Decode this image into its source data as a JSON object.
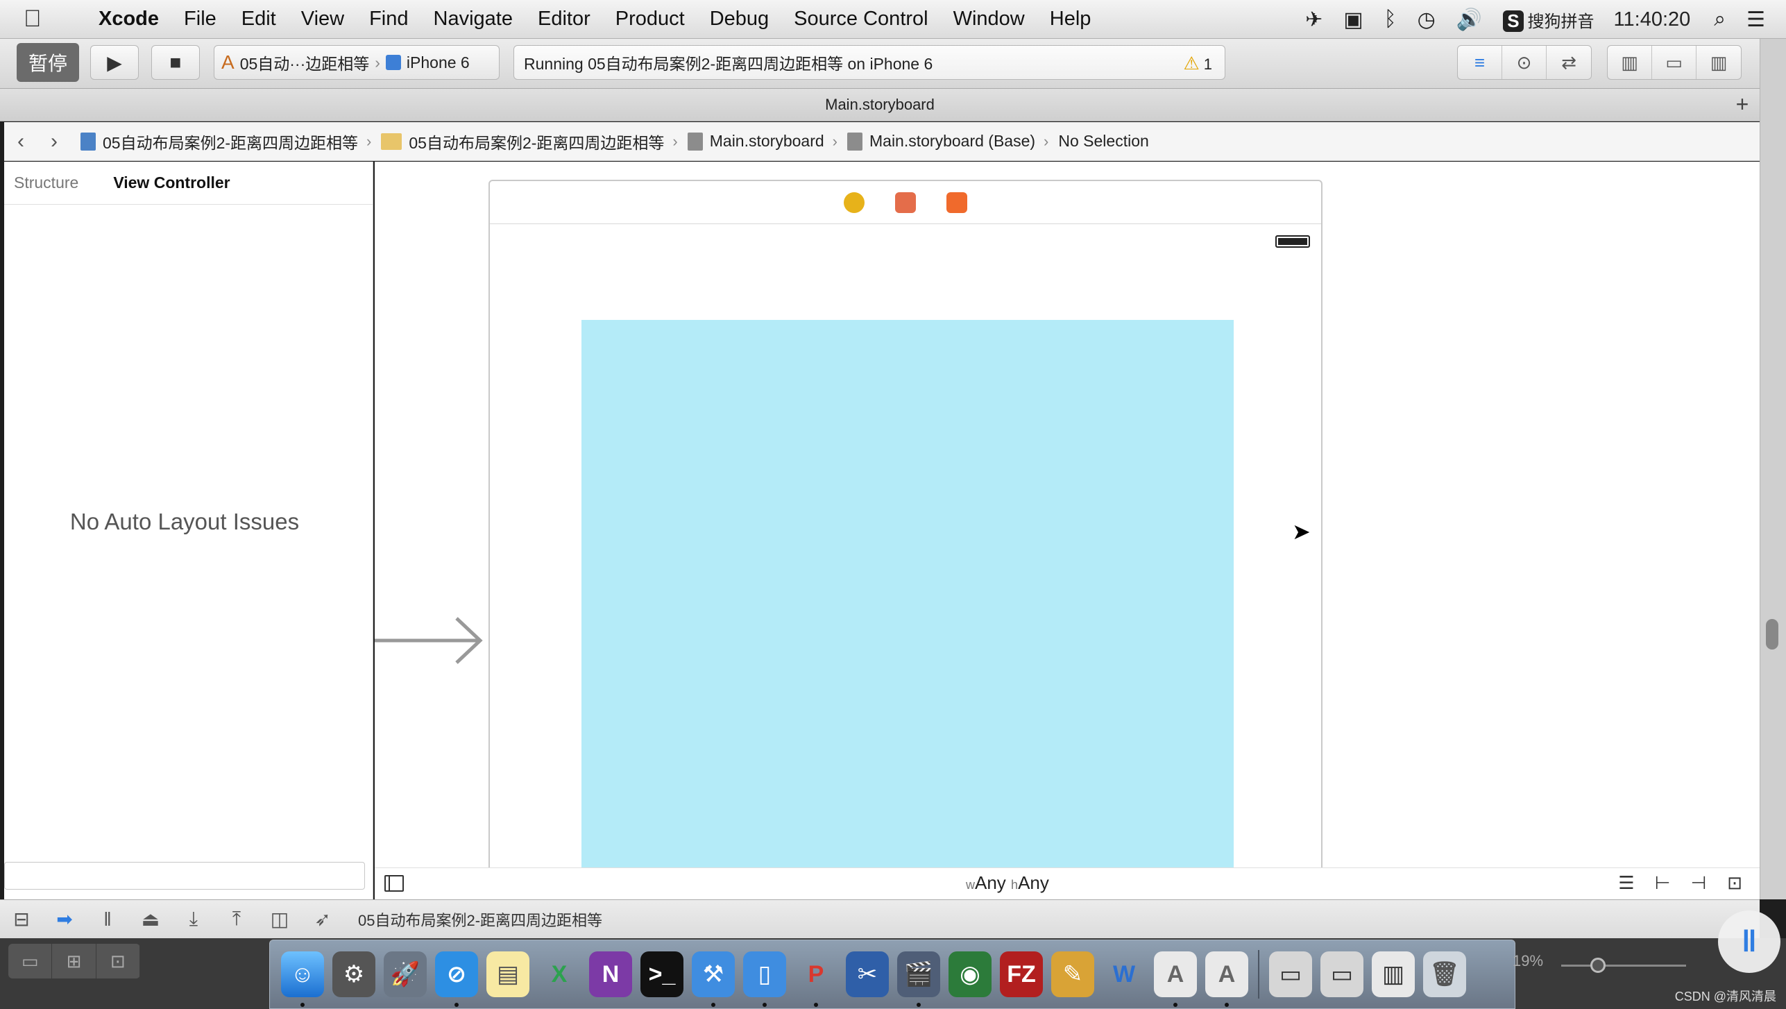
{
  "menubar": {
    "apple": "",
    "items": [
      "Xcode",
      "File",
      "Edit",
      "View",
      "Find",
      "Navigate",
      "Editor",
      "Product",
      "Debug",
      "Source Control",
      "Window",
      "Help"
    ],
    "ime": "搜狗拼音",
    "clock": "11:40:20"
  },
  "toolbar": {
    "pause_label": "暂停",
    "scheme_name": "05自动···边距相等",
    "device": "iPhone 6",
    "status": "Running 05自动布局案例2-距离四周边距相等 on iPhone 6",
    "warning_count": "1"
  },
  "tab": {
    "title": "Main.storyboard",
    "add": "+"
  },
  "jumpbar": {
    "crumbs": [
      "05自动布局案例2-距离四周边距相等",
      "05自动布局案例2-距离四周边距相等",
      "Main.storyboard",
      "Main.storyboard (Base)",
      "No Selection"
    ]
  },
  "outline": {
    "tab_structure": "Structure",
    "tab_vc": "View Controller",
    "empty_message": "No Auto Layout Issues"
  },
  "canvas": {
    "size_w_prefix": "w",
    "size_w": "Any",
    "size_h_prefix": "h",
    "size_h": "Any",
    "view_color": "#b4ebf8"
  },
  "debugbar": {
    "process": "05自动布局案例2-距离四周边距相等"
  },
  "dock": {
    "zoom": "19%",
    "watermark": "CSDN @清风清晨"
  },
  "colors": {
    "accent": "#2f7de1",
    "view_bg": "#b4ebf8"
  }
}
